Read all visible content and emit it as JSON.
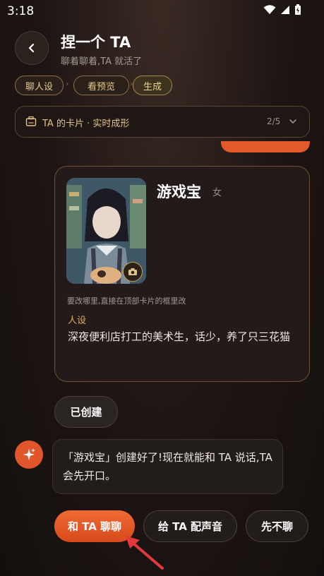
{
  "status_bar": {
    "time": "3:18",
    "icons": [
      "wifi-icon",
      "signal-icon",
      "battery-icon"
    ]
  },
  "header": {
    "back_icon": "chevron-left-icon",
    "title": "捏一个 TA",
    "subtitle": "聊着聊着,TA 就活了"
  },
  "steps": [
    {
      "label": "聊人设"
    },
    {
      "label": "看预览"
    },
    {
      "label": "生成"
    }
  ],
  "card_bar": {
    "icon": "card-icon",
    "label": "TA 的卡片 · 实时成形",
    "count": "2/5",
    "chevron": "chevron-down-icon"
  },
  "profile_card": {
    "name": "游戏宝",
    "gender": "女",
    "hint": "要改哪里,直接在顶部卡片的框里改",
    "persona_label": "人设",
    "persona_text": "深夜便利店打工的美术生，话少，养了只三花猫"
  },
  "created_pill": "已创建",
  "bot_message": "「游戏宝」创建好了!现在就能和 TA 说话,TA 会先开口。",
  "actions": {
    "chat": "和 TA 聊聊",
    "voice": "给 TA 配声音",
    "later": "先不聊"
  },
  "colors": {
    "accent_orange": "#e25a2a",
    "gold": "#e0c28a",
    "background": "#1d1513"
  }
}
